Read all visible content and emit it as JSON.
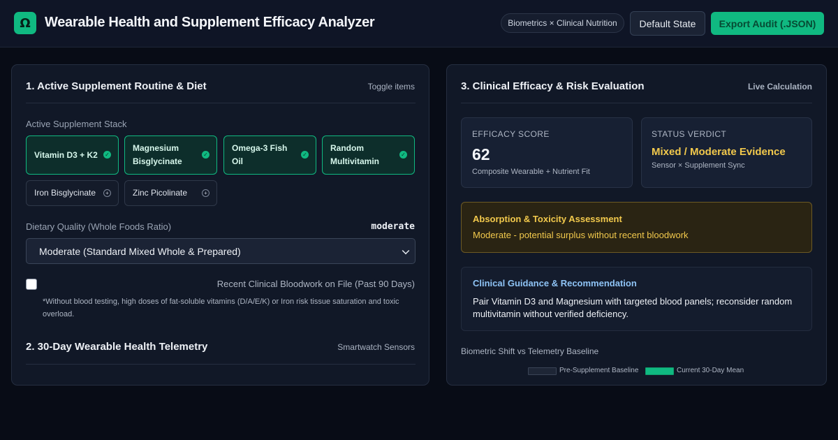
{
  "header": {
    "logo_glyph": "Ω",
    "title": "Wearable Health and Supplement Efficacy Analyzer",
    "tag": "Biometrics × Clinical Nutrition",
    "default_button": "Default State",
    "export_button": "Export Audit (.JSON)"
  },
  "routine": {
    "title": "1. Active Supplement Routine & Diet",
    "meta": "Toggle items",
    "stack_label": "Active Supplement Stack",
    "active": [
      {
        "label": "Vitamin D3 + K2"
      },
      {
        "label": "Magnesium Bisglycinate"
      },
      {
        "label": "Omega-3 Fish Oil"
      },
      {
        "label": "Random Multivitamin"
      }
    ],
    "inactive": [
      {
        "label": "Iron Bisglycinate"
      },
      {
        "label": "Zinc Picolinate"
      }
    ],
    "active_mark": "✓",
    "inactive_mark": "+",
    "diet_label": "Dietary Quality (Whole Foods Ratio)",
    "diet_value": "moderate",
    "diet_selected": "Moderate (Standard Mixed Whole & Prepared)",
    "bloodwork_label": "Recent Clinical Bloodwork on File (Past 90 Days)",
    "bloodwork_checked": false,
    "bloodwork_note": "*Without blood testing, high doses of fat-soluble vitamins (D/A/E/K) or Iron risk tissue saturation and toxic overload."
  },
  "telemetry": {
    "title": "2. 30-Day Wearable Health Telemetry",
    "meta": "Smartwatch Sensors"
  },
  "evaluation": {
    "title": "3. Clinical Efficacy & Risk Evaluation",
    "meta": "Live Calculation",
    "efficacy": {
      "label": "Efficacy Score",
      "value": "62",
      "sub": "Composite Wearable + Nutrient Fit"
    },
    "verdict": {
      "label": "Status Verdict",
      "value": "Mixed / Moderate Evidence",
      "sub": "Sensor × Supplement Sync"
    },
    "assessment": {
      "title": "Absorption & Toxicity Assessment",
      "text": "Moderate - potential surplus without recent bloodwork"
    },
    "guidance": {
      "title": "Clinical Guidance & Recommendation",
      "text": "Pair Vitamin D3 and Magnesium with targeted blood panels; reconsider random multivitamin without verified deficiency."
    },
    "chart_title": "Biometric Shift vs Telemetry Baseline",
    "legend": [
      {
        "name": "Pre-Supplement Baseline",
        "color": "#1e2636"
      },
      {
        "name": "Current 30-Day Mean",
        "color": "#10b981"
      }
    ]
  },
  "colors": {
    "accent": "#10b981",
    "warning": "#f2c94c",
    "info": "#8ec3f5"
  }
}
